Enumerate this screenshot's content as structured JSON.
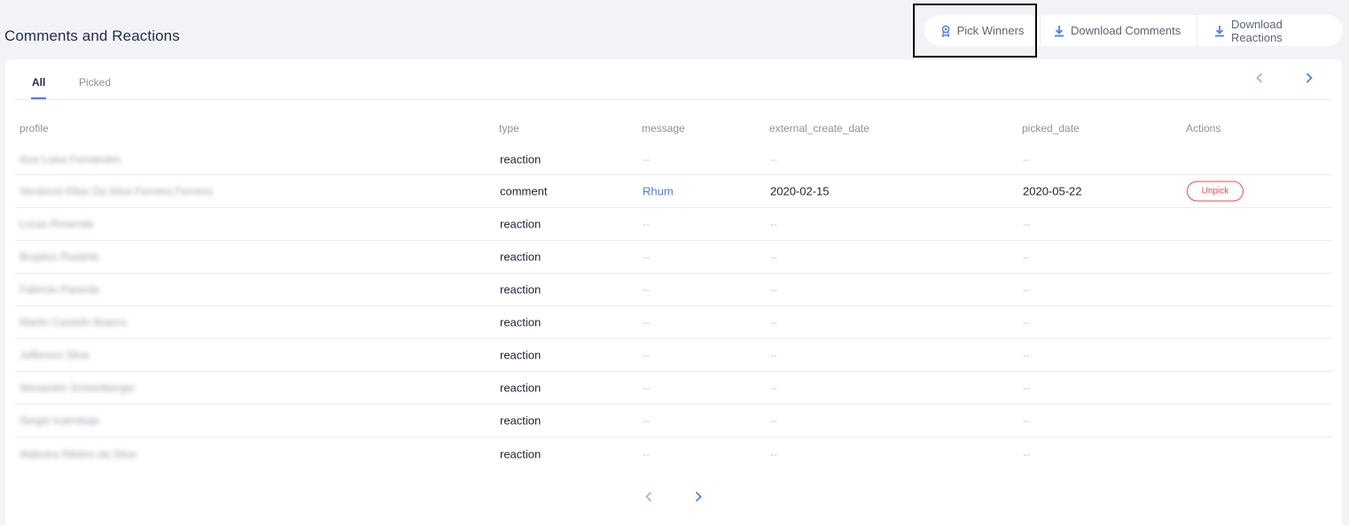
{
  "header": {
    "title": "Comments and Reactions"
  },
  "toolbar": {
    "pick_winners_label": "Pick Winners",
    "download_comments_label": "Download Comments",
    "download_reactions_label": "Download Reactions"
  },
  "tabs": [
    {
      "label": "All",
      "active": true
    },
    {
      "label": "Picked",
      "active": false
    }
  ],
  "columns": {
    "profile": "profile",
    "type": "type",
    "message": "message",
    "external_create_date": "external_create_date",
    "picked_date": "picked_date",
    "actions": "Actions"
  },
  "rows": [
    {
      "profile": "Ana Luisa Fernandes",
      "type": "reaction",
      "message": "--",
      "external_create_date": "--",
      "picked_date": "--",
      "action": ""
    },
    {
      "profile": "Venâncio Elias Da Silva Ferreira Ferreira",
      "type": "comment",
      "message": "Rhum",
      "external_create_date": "2020-02-15",
      "picked_date": "2020-05-22",
      "action": "Unpick"
    },
    {
      "profile": "Lucas Resende",
      "type": "reaction",
      "message": "--",
      "external_create_date": "--",
      "picked_date": "--",
      "action": ""
    },
    {
      "profile": "Bruplius Rodarte",
      "type": "reaction",
      "message": "--",
      "external_create_date": "--",
      "picked_date": "--",
      "action": ""
    },
    {
      "profile": "Fabricio Pazente",
      "type": "reaction",
      "message": "--",
      "external_create_date": "--",
      "picked_date": "--",
      "action": ""
    },
    {
      "profile": "Martin Castello Branco",
      "type": "reaction",
      "message": "--",
      "external_create_date": "--",
      "picked_date": "--",
      "action": ""
    },
    {
      "profile": "Jefferson Silva",
      "type": "reaction",
      "message": "--",
      "external_create_date": "--",
      "picked_date": "--",
      "action": ""
    },
    {
      "profile": "Alexandre Schweiberger",
      "type": "reaction",
      "message": "--",
      "external_create_date": "--",
      "picked_date": "--",
      "action": ""
    },
    {
      "profile": "Sergio Icaimbuja",
      "type": "reaction",
      "message": "--",
      "external_create_date": "--",
      "picked_date": "--",
      "action": ""
    },
    {
      "profile": "Aldenira Ribeiro da Silva",
      "type": "reaction",
      "message": "--",
      "external_create_date": "--",
      "picked_date": "--",
      "action": ""
    }
  ],
  "colors": {
    "accent": "#4a7fe0",
    "danger": "#d9534f",
    "title": "#1f2d4e",
    "background": "#f3f3f7"
  },
  "icons": {
    "pick_winners": "award-icon",
    "download": "download-icon",
    "prev": "chevron-left-icon",
    "next": "chevron-right-icon"
  }
}
